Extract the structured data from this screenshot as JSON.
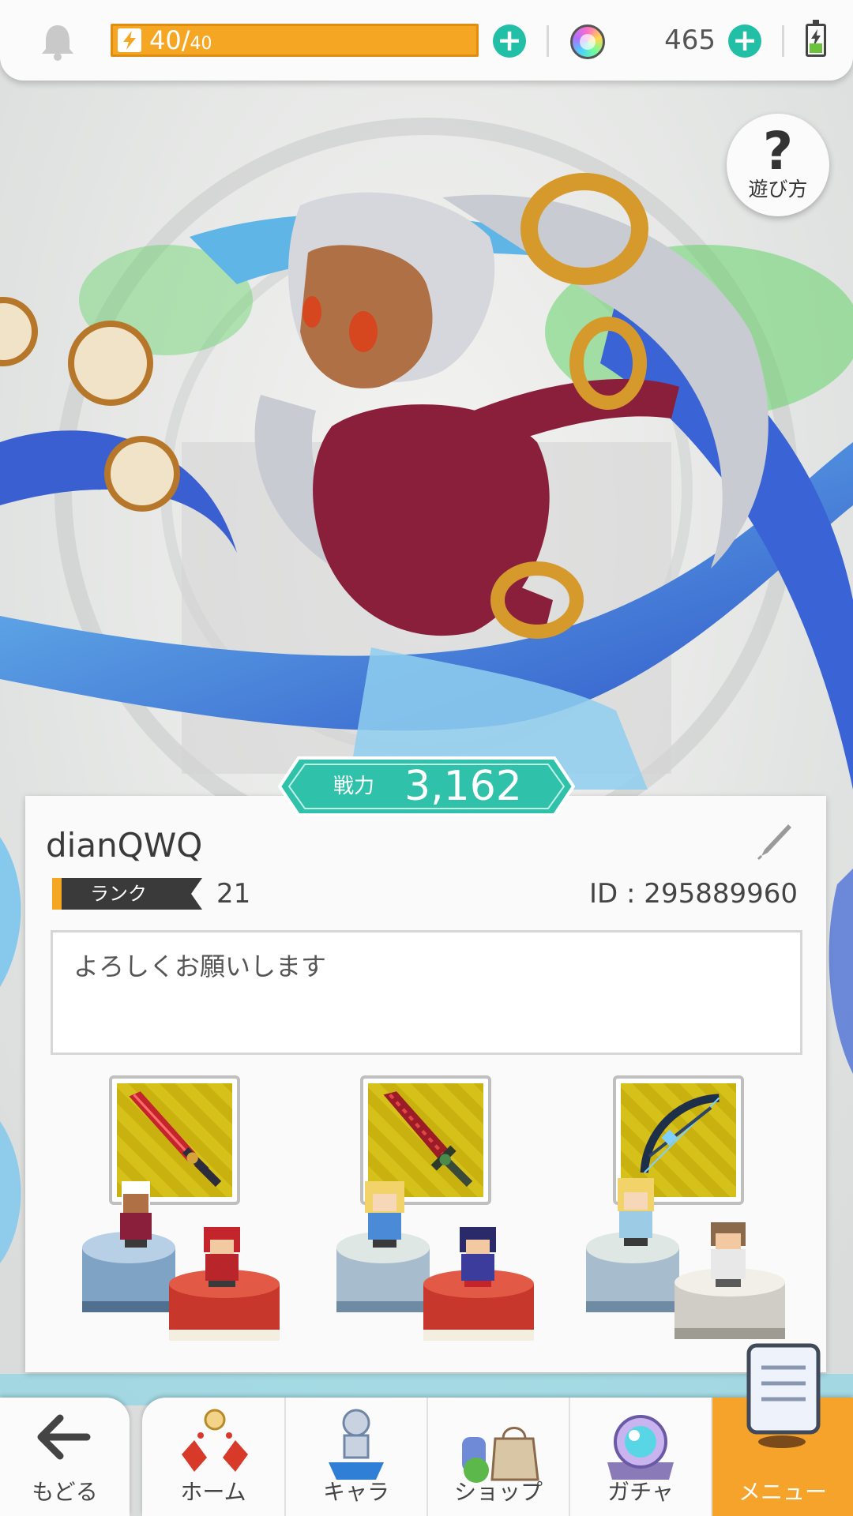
{
  "top_bar": {
    "icons": [
      "bell-icon",
      "bolt-icon",
      "gem-icon",
      "battery-icon"
    ],
    "stamina_current": "40/",
    "stamina_max": "40",
    "stamina_fraction": 1.0,
    "gem_count": "465",
    "plus_symbol": "+"
  },
  "help": {
    "symbol": "?",
    "label": "遊び方"
  },
  "power": {
    "label": "戦力",
    "value": "3,162"
  },
  "profile": {
    "username": "dianQWQ",
    "rank_label": "ランク",
    "rank_value": "21",
    "id_text": "ID : 295889960",
    "bio": "よろしくお願いします"
  },
  "teams": [
    {
      "weapon": "sword-icon"
    },
    {
      "weapon": "sword-icon"
    },
    {
      "weapon": "bow-icon"
    }
  ],
  "nav": {
    "back_label": "もどる",
    "tabs": [
      {
        "label": "ホーム",
        "icon": "home-icon"
      },
      {
        "label": "キャラ",
        "icon": "character-icon"
      },
      {
        "label": "ショップ",
        "icon": "shop-icon"
      },
      {
        "label": "ガチャ",
        "icon": "gacha-icon"
      },
      {
        "label": "メニュー",
        "icon": "menu-book-icon"
      }
    ]
  },
  "colors": {
    "accent_teal": "#21bfa6",
    "stamina_orange": "#f5a623",
    "menu_orange": "#f5a32a",
    "rank_dark": "#3a3a3a"
  }
}
